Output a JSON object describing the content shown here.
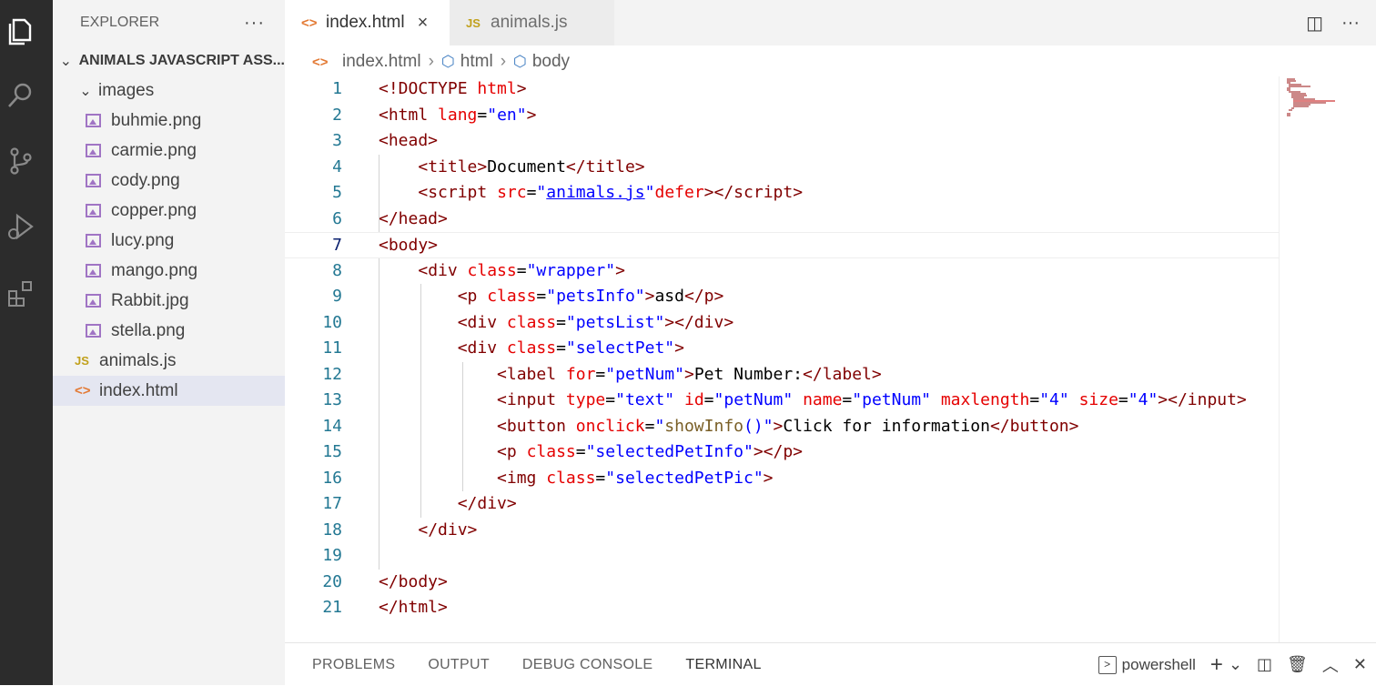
{
  "activity_bar": [
    "explorer-icon",
    "search-icon",
    "source-control-icon",
    "run-debug-icon",
    "extensions-icon"
  ],
  "sidebar": {
    "title": "EXPLORER",
    "more": "···",
    "root_folder": "ANIMALS JAVASCRIPT ASS...",
    "subfolder": "images",
    "images": [
      "buhmie.png",
      "carmie.png",
      "cody.png",
      "copper.png",
      "lucy.png",
      "mango.png",
      "Rabbit.jpg",
      "stella.png"
    ],
    "files": [
      {
        "icon": "JS",
        "name": "animals.js"
      },
      {
        "icon": "<>",
        "name": "index.html"
      }
    ]
  },
  "tabs": [
    {
      "icon": "<>",
      "label": "index.html",
      "close": "×"
    },
    {
      "icon": "JS",
      "label": "animals.js"
    }
  ],
  "tab_actions": {
    "split": "◫",
    "more": "···"
  },
  "breadcrumbs": {
    "file": "index.html",
    "items": [
      "html",
      "body"
    ]
  },
  "editor": {
    "line_numbers": [
      "1",
      "2",
      "3",
      "4",
      "5",
      "6",
      "7",
      "8",
      "9",
      "10",
      "11",
      "12",
      "13",
      "14",
      "15",
      "16",
      "17",
      "18",
      "19",
      "20",
      "21"
    ],
    "current_line": 7
  },
  "panel": {
    "tabs": [
      "PROBLEMS",
      "OUTPUT",
      "DEBUG CONSOLE",
      "TERMINAL"
    ],
    "active_tab": "TERMINAL",
    "terminal_name": "powershell",
    "actions": [
      "+",
      "⌄",
      "◫",
      "🗑",
      "︿",
      "✕"
    ]
  }
}
